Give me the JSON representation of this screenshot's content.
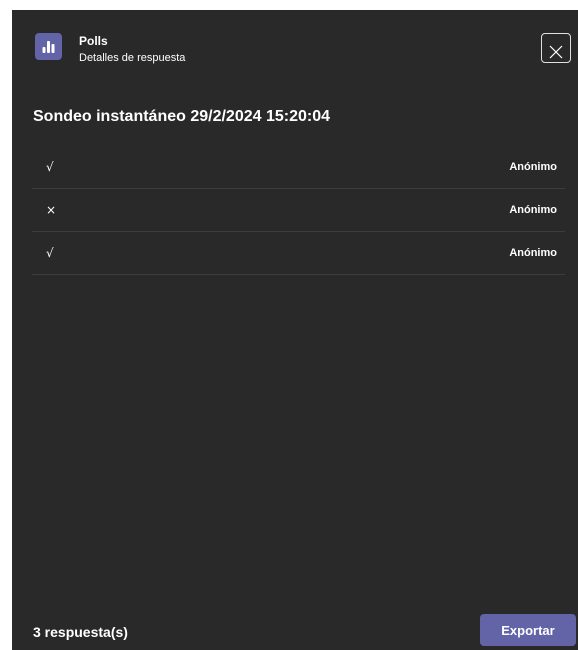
{
  "header": {
    "app_name": "Polls",
    "subtitle": "Detalles de respuesta",
    "app_icon": "bar-chart-icon",
    "close_icon": "close-icon"
  },
  "poll": {
    "title": "Sondeo instantáneo 29/2/2024 15:20:04"
  },
  "responses": [
    {
      "answer": "√",
      "respondent": "Anónimo"
    },
    {
      "answer": "×",
      "respondent": "Anónimo"
    },
    {
      "answer": "√",
      "respondent": "Anónimo"
    }
  ],
  "footer": {
    "count_label": "3 respuesta(s)",
    "export_label": "Exportar"
  },
  "colors": {
    "background": "#292929",
    "accent": "#6264a7",
    "divider": "#3d3d3d",
    "text": "#ffffff"
  }
}
